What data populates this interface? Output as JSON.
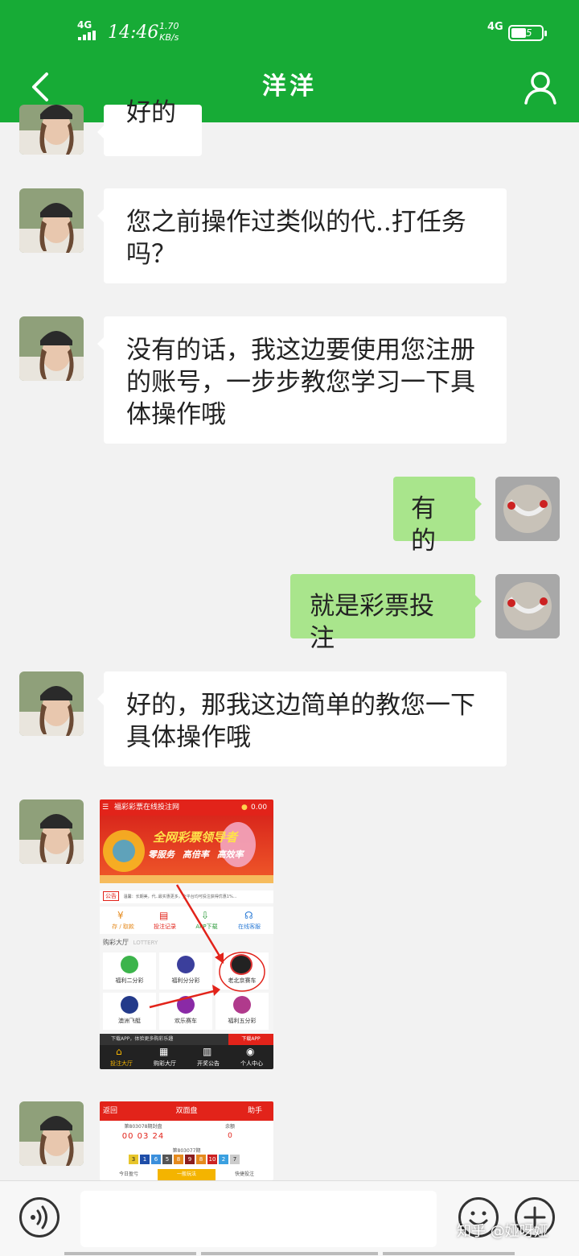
{
  "status_bar": {
    "network_left": "4G",
    "time": "14:46",
    "speed_value": "1.70",
    "speed_unit": "KB/s",
    "network_right": "4G",
    "battery": "35"
  },
  "header": {
    "title": "洋洋"
  },
  "messages": [
    {
      "side": "left",
      "text": "好的"
    },
    {
      "side": "left",
      "text": "您之前操作过类似的代..打任务吗？"
    },
    {
      "side": "left",
      "text": "没有的话，我这边要使用您注册的账号，一步步教您学习一下具体操作哦"
    },
    {
      "side": "right",
      "text": "有的"
    },
    {
      "side": "right",
      "text": "就是彩票投注"
    },
    {
      "side": "left",
      "text": "好的，那我这边简单的教您一下具体操作哦"
    }
  ],
  "screenshot1": {
    "header_title": "福彩彩票在线投注网",
    "coins": "0.00",
    "banner_title": "全网彩票领导者",
    "banner_tags": [
      "零服务",
      "高倍率",
      "高效率"
    ],
    "notice_label": "公告",
    "notice_text": "温馨：长期美，代..最实惠更多，全平台均可投注获得优惠1%...",
    "quick_links": [
      "存 / 取款",
      "投注记录",
      "APP下载",
      "在线客服"
    ],
    "section_label": "购彩大厅",
    "section_sub": "LOTTERY",
    "games": [
      "福利二分彩",
      "福利分分彩",
      "老北京赛车",
      "澳洲飞艇",
      "欢乐赛车",
      "福利五分彩"
    ],
    "download_text": "下载APP，体验更多购彩乐趣",
    "download_button": "下载APP",
    "tabs": [
      "投注大厅",
      "购彩大厅",
      "开奖公告",
      "个人中心"
    ],
    "colors": {
      "header": "#e2231a",
      "tab_active": "#f4b400",
      "tab_bar": "#222222"
    }
  },
  "screenshot2": {
    "back_label": "返回",
    "title": "双面盘",
    "help_label": "助手",
    "period_label": "第803078期封盘",
    "countdown": "00 03 24",
    "balance_label": "余额",
    "balance_value": "0",
    "prev_period": "第803077期",
    "balls": [
      "3",
      "1",
      "6",
      "5",
      "8",
      "9",
      "8",
      "10",
      "2",
      "7"
    ],
    "tabs": [
      "今日盈亏",
      "一般玩法",
      "快捷投注"
    ]
  },
  "watermark": "知乎 @娅呀娅"
}
